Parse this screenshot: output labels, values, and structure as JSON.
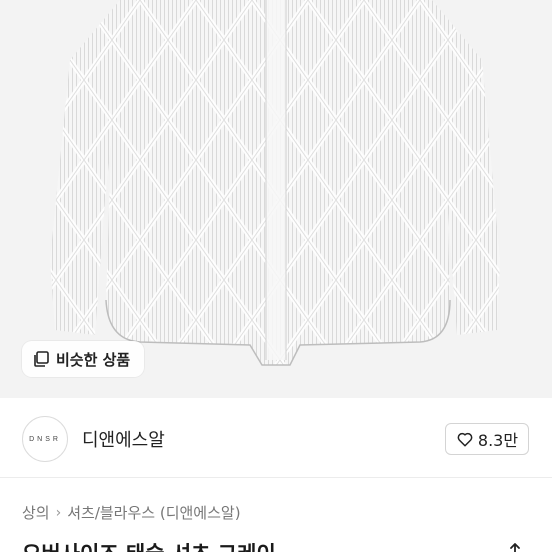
{
  "image": {
    "similar_button_label": "비슷한 상품"
  },
  "seller": {
    "avatar_text": "DNSR",
    "name": "디앤에스알",
    "likes": "8.3만"
  },
  "breadcrumb": {
    "items": [
      "상의",
      "셔츠/블라우스 (디앤에스알)"
    ]
  },
  "product": {
    "title": "오버사이즈 태슬 셔츠 그레이"
  },
  "icons": {
    "similar": "stacked-squares-icon",
    "like": "heart-icon",
    "separator": "chevron-right-icon",
    "share": "share-icon"
  }
}
